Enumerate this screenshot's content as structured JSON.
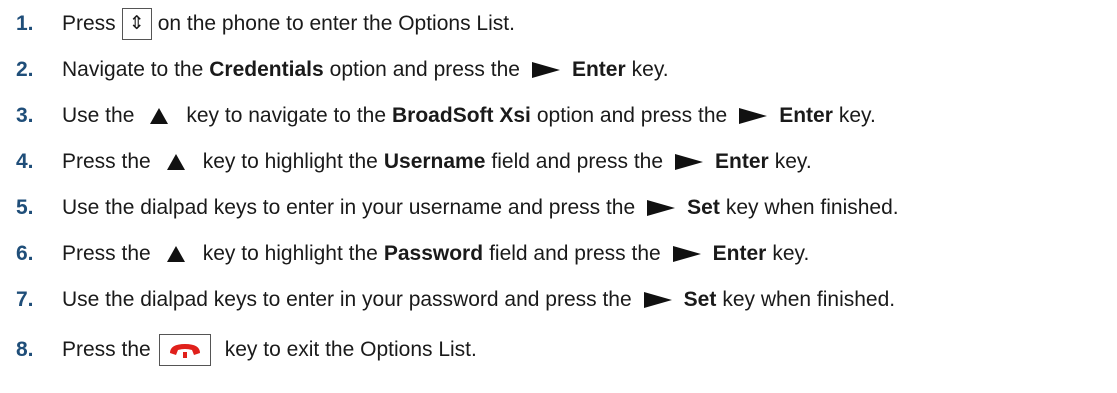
{
  "steps": [
    {
      "num": "1.",
      "parts": [
        "Press",
        "on the phone to enter the Options List."
      ]
    },
    {
      "num": "2.",
      "parts": [
        "Navigate to the",
        "Credentials",
        "option and press the",
        "Enter",
        "key."
      ]
    },
    {
      "num": "3.",
      "parts": [
        "Use the",
        "key to navigate to the",
        "BroadSoft Xsi",
        "option and press the",
        "Enter",
        "key."
      ]
    },
    {
      "num": "4.",
      "parts": [
        "Press the",
        "key to highlight the",
        "Username",
        "field and press the",
        "Enter",
        "key."
      ]
    },
    {
      "num": "5.",
      "parts": [
        "Use the dialpad keys to enter in your username and press the",
        "Set",
        "key when finished."
      ]
    },
    {
      "num": "6.",
      "parts": [
        "Press the",
        "key to highlight the",
        "Password",
        "field and press the",
        "Enter",
        "key."
      ]
    },
    {
      "num": "7.",
      "parts": [
        "Use the dialpad keys to enter in your password and press the",
        "Set",
        "key when finished."
      ]
    },
    {
      "num": "8.",
      "parts": [
        "Press the",
        "key to exit the Options List."
      ]
    }
  ],
  "icons": {
    "options_key": "options-key-icon",
    "up_arrow": "up-arrow-key-icon",
    "right_arrow": "right-arrow-enter-icon",
    "end_call": "end-call-key-icon"
  },
  "colors": {
    "step_number": "#1f4e79",
    "end_call_red": "#e0201b",
    "arrow": "#111111"
  }
}
